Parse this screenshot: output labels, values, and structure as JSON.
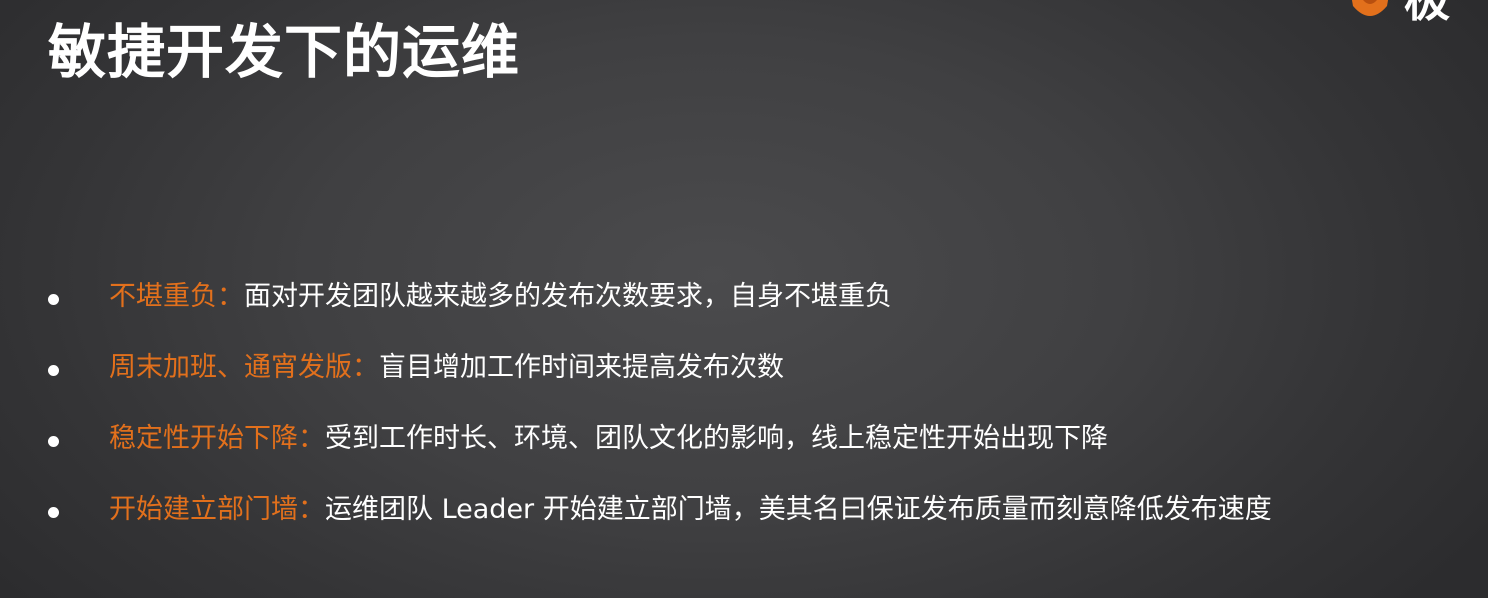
{
  "slide": {
    "title": "敏捷开发下的运维",
    "logo_text": "极",
    "colors": {
      "background": "#404042",
      "title": "#ffffff",
      "term": "#e2701c",
      "description": "#ffffff",
      "logo": "#e2701c"
    }
  },
  "bullets": [
    {
      "term": "不堪重负：",
      "description": "面对开发团队越来越多的发布次数要求，自身不堪重负"
    },
    {
      "term": "周末加班、通宵发版：",
      "description": "盲目增加工作时间来提高发布次数"
    },
    {
      "term": "稳定性开始下降：",
      "description": "受到工作时长、环境、团队文化的影响，线上稳定性开始出现下降"
    },
    {
      "term": "开始建立部门墙：",
      "description": "运维团队 Leader 开始建立部门墙，美其名曰保证发布质量而刻意降低发布速度"
    }
  ]
}
